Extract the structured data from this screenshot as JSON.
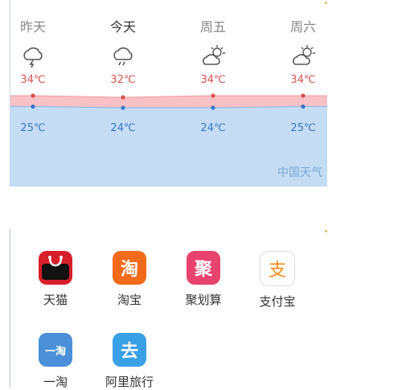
{
  "weather": {
    "days": [
      {
        "label": "昨天",
        "high": "34℃",
        "low": "25℃",
        "high_value": 34,
        "low_value": 25,
        "icon": "thunderstorm-icon",
        "today": false
      },
      {
        "label": "今天",
        "high": "32℃",
        "low": "24℃",
        "high_value": 32,
        "low_value": 24,
        "icon": "rain-cloud-icon",
        "today": true
      },
      {
        "label": "周五",
        "high": "34℃",
        "low": "24℃",
        "high_value": 34,
        "low_value": 24,
        "icon": "partly-sunny-icon",
        "today": false
      },
      {
        "label": "周六",
        "high": "34℃",
        "low": "25℃",
        "high_value": 34,
        "low_value": 25,
        "icon": "partly-sunny-icon",
        "today": false
      }
    ],
    "brand": "中国天气",
    "colors": {
      "high": "#d9534f",
      "low": "#3a77c2",
      "band": "#f7c1c6",
      "area": "#c4dcf4"
    }
  },
  "apps": {
    "items": [
      {
        "name": "天猫",
        "icon": "tmall-icon",
        "glyph": "",
        "color": "#d71f2b"
      },
      {
        "name": "淘宝",
        "icon": "taobao-icon",
        "glyph": "淘",
        "color": "#f26a1b"
      },
      {
        "name": "聚划算",
        "icon": "juhuasuan-icon",
        "glyph": "聚",
        "color": "#e8436e"
      },
      {
        "name": "支付宝",
        "icon": "alipay-icon",
        "glyph": "支",
        "color": "#ffffff"
      },
      {
        "name": "一淘",
        "icon": "yitao-icon",
        "glyph": "一淘",
        "color": "#4a8fd8"
      },
      {
        "name": "阿里旅行",
        "icon": "alitrip-icon",
        "glyph": "去",
        "color": "#3aa0e6"
      }
    ]
  }
}
